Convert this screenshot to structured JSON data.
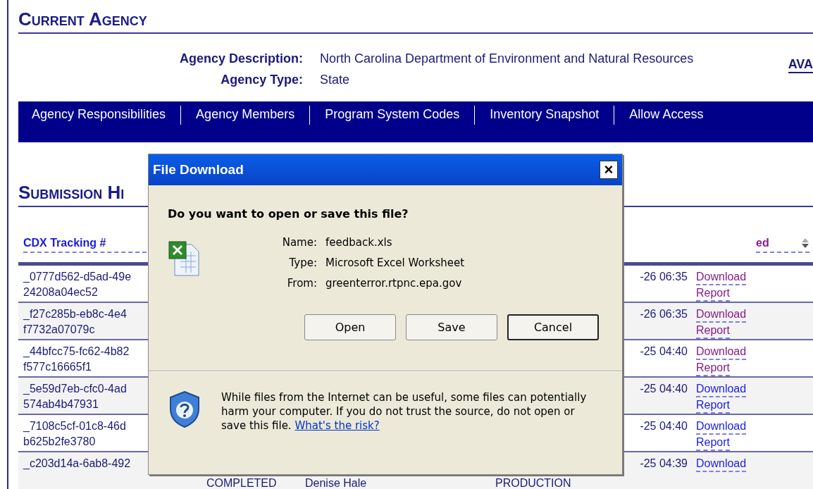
{
  "current_agency": {
    "title": "Current Agency",
    "fields": [
      {
        "label": "Agency Description:",
        "value": "North Carolina Department of Environment and Natural Resources"
      },
      {
        "label": "Agency Type:",
        "value": "State"
      }
    ],
    "side_link": "AVA"
  },
  "tabs": [
    {
      "label": "Agency Responsibilities"
    },
    {
      "label": "Agency Members"
    },
    {
      "label": "Program System Codes"
    },
    {
      "label": "Inventory Snapshot"
    },
    {
      "label": "Allow Access"
    }
  ],
  "submission_history": {
    "title": "Submission Hi",
    "columns": [
      {
        "label": "CDX Tracking #",
        "sortable": false
      },
      {
        "label": "ed",
        "sortable": true
      }
    ],
    "rows": [
      {
        "tracking": "_0777d562-d5ad-49e\n24208a04ec52",
        "date": "-26 06:35",
        "link_1": "Download",
        "link_2": "Report",
        "visited": true
      },
      {
        "tracking": "_f27c285b-eb8c-4e4\nf7732a07079c",
        "date": "-26 06:35",
        "link_1": "Download",
        "link_2": "Report",
        "visited": true
      },
      {
        "tracking": "_44bfcc75-fc62-4b82\nf577c16665f1",
        "date": "-25 04:40",
        "link_1": "Download",
        "link_2": "Report",
        "visited": true
      },
      {
        "tracking": "_5e59d7eb-cfc0-4ad\n574ab4b47931",
        "date": "-25 04:40",
        "link_1": "Download",
        "link_2": "Report",
        "visited": false
      },
      {
        "tracking": "_7108c5cf-01c8-46d\nb625b2fe3780",
        "date": "-25 04:40",
        "link_1": "Download",
        "link_2": "Report",
        "visited": false
      },
      {
        "tracking": "_c203d14a-6ab8-492",
        "status": "COMPLETED",
        "submitter": "Denise Hale",
        "environment": "PRODUCTION",
        "date": "-25 04:39",
        "link_1": "Download",
        "visited": false
      }
    ]
  },
  "dialog": {
    "title": "File Download",
    "question": "Do you want to open or save this file?",
    "fields": [
      {
        "label": "Name:",
        "value": "feedback.xls"
      },
      {
        "label": "Type:",
        "value": "Microsoft Excel Worksheet"
      },
      {
        "label": "From:",
        "value": "greenterror.rtpnc.epa.gov"
      }
    ],
    "buttons": [
      {
        "label": "Open",
        "default": false
      },
      {
        "label": "Save",
        "default": false
      },
      {
        "label": "Cancel",
        "default": true
      }
    ],
    "close": "×",
    "warning": "While files from the Internet can be useful, some files can potentially harm your computer. If you do not trust the source, do not open or save this file.",
    "risk_link": "What's the risk?"
  }
}
